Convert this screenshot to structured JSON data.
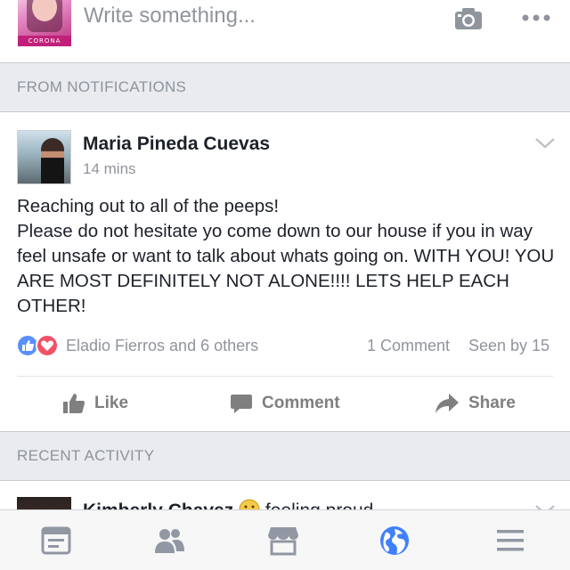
{
  "composer": {
    "placeholder": "Write something...",
    "avatar_brand": "CORONA",
    "icons": [
      "camera-icon",
      "more-icon"
    ]
  },
  "sections": {
    "notifications": "FROM NOTIFICATIONS",
    "recent": "RECENT ACTIVITY"
  },
  "post": {
    "author": "Maria Pineda Cuevas",
    "time": "14 mins",
    "body": "Reaching out to all of the peeps!\nPlease do not hesitate yo come down to our house if you in way feel unsafe or want to talk about whats going on. WITH YOU! YOU ARE MOST DEFINITELY NOT ALONE!!!! LETS HELP EACH OTHER!",
    "reactions": [
      "like",
      "love"
    ],
    "liked_by": "Eladio Fierros and 6 others",
    "comments": "1 Comment",
    "seen_by": "Seen by 15",
    "actions": {
      "like": "Like",
      "comment": "Comment",
      "share": "Share"
    }
  },
  "next_post": {
    "author": "Kimberly Chavez",
    "feeling": "feeling proud."
  },
  "tabbar": {
    "tabs": [
      "news-feed-icon",
      "friends-icon",
      "marketplace-icon",
      "notifications-globe-icon",
      "menu-icon"
    ],
    "active": "notifications-globe-icon",
    "accent": "#4080ff",
    "inactive": "#9197a3"
  },
  "colors": {
    "text": "#1d2129",
    "secondary": "#90949c",
    "like": "#5890ff",
    "love": "#f25268"
  }
}
